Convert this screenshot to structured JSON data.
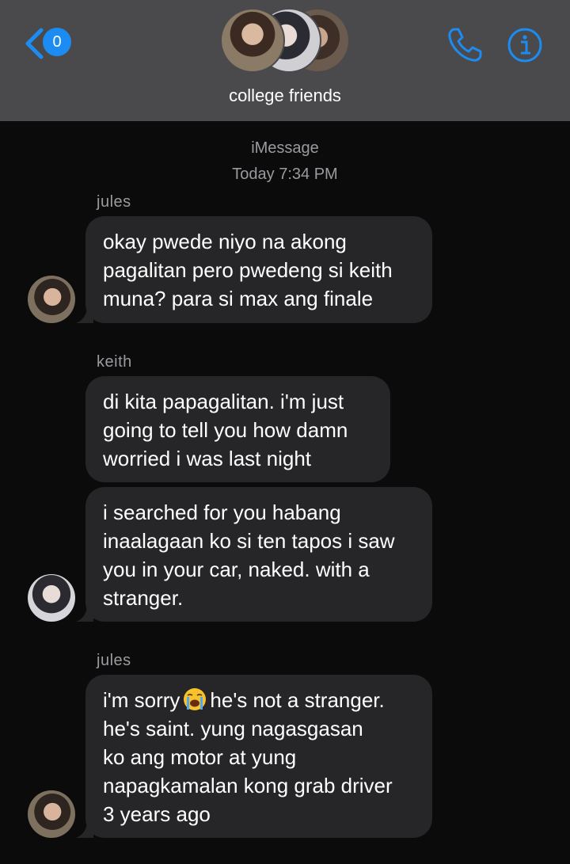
{
  "header": {
    "back_badge_count": "0",
    "group_name": "college friends",
    "icons": {
      "back": "chevron-left-icon",
      "call": "phone-icon",
      "info": "info-icon"
    },
    "accent_color": "#1c8cf2"
  },
  "conversation": {
    "service_label": "iMessage",
    "timestamp": "Today 7:34 PM",
    "messages": [
      {
        "sender": "jules",
        "text": "okay pwede niyo na akong\npagalitan pero pwedeng si keith\nmuna? para si max ang finale"
      },
      {
        "sender": "keith",
        "text": "di kita papagalitan. i'm just\ngoing to tell you how damn\nworried i was last night"
      },
      {
        "sender": "keith",
        "text": "i searched for you habang\ninaalagaan ko si ten tapos i saw\nyou in your car, naked. with a\nstranger."
      },
      {
        "sender": "jules",
        "text_before_emoji": "i'm sorry",
        "emoji": "loudly-crying-face-icon",
        "text_after_emoji": "he's not a stranger.",
        "text_rest": "he's saint. yung nagasgasan\nko ang motor at yung\nnapagkamalan kong grab driver\n3 years ago"
      }
    ]
  },
  "colors": {
    "header_bg": "#4a4a4c",
    "screen_bg": "#0b0b0c",
    "bubble_bg": "#262628",
    "meta_text": "#9b9b9f"
  }
}
